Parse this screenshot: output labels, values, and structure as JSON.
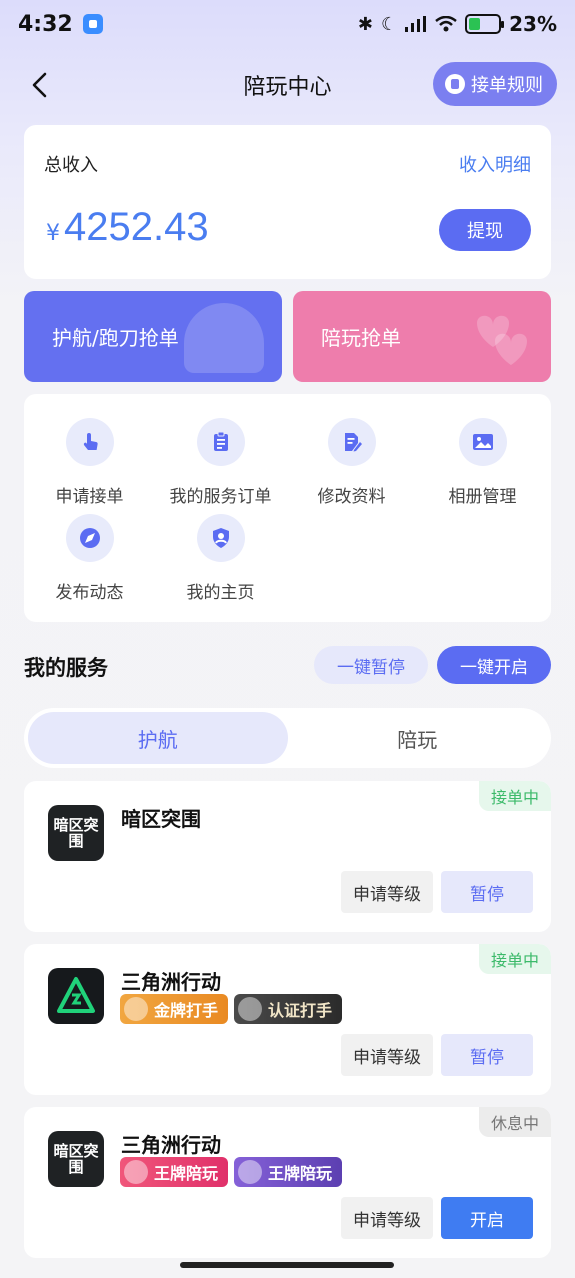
{
  "status_bar": {
    "time": "4:32",
    "battery_percent": "23%"
  },
  "nav": {
    "title": "陪玩中心",
    "rules_label": "接单规则"
  },
  "income": {
    "label": "总收入",
    "detail_link": "收入明细",
    "currency": "¥",
    "amount": "4252.43",
    "withdraw_label": "提现"
  },
  "grab": {
    "escort_label": "护航/跑刀抢单",
    "play_label": "陪玩抢单"
  },
  "menu": {
    "items": [
      {
        "label": "申请接单",
        "icon": "hand-pointer-icon"
      },
      {
        "label": "我的服务订单",
        "icon": "clipboard-icon"
      },
      {
        "label": "修改资料",
        "icon": "edit-document-icon"
      },
      {
        "label": "相册管理",
        "icon": "image-icon"
      },
      {
        "label": "发布动态",
        "icon": "compass-icon"
      },
      {
        "label": "我的主页",
        "icon": "user-shield-icon"
      }
    ]
  },
  "services": {
    "title": "我的服务",
    "pause_all_label": "一键暂停",
    "open_all_label": "一键开启",
    "tabs": [
      {
        "label": "护航"
      },
      {
        "label": "陪玩"
      }
    ],
    "cards": [
      {
        "game": "暗区突围",
        "icon_text": "暗区突围",
        "status": "接单中",
        "level_label": "申请等级",
        "action_label": "暂停"
      },
      {
        "game": "三角洲行动",
        "status": "接单中",
        "badges": [
          "金牌打手",
          "认证打手"
        ],
        "level_label": "申请等级",
        "action_label": "暂停"
      },
      {
        "game": "三角洲行动",
        "icon_text": "暗区突围",
        "status": "休息中",
        "badges": [
          "王牌陪玩",
          "王牌陪玩"
        ],
        "level_label": "申请等级",
        "action_label": "开启"
      }
    ]
  },
  "colors": {
    "accent": "#5b6cf2",
    "link": "#4a7df0",
    "pink": "#ee7dac",
    "green": "#3cba6a"
  }
}
